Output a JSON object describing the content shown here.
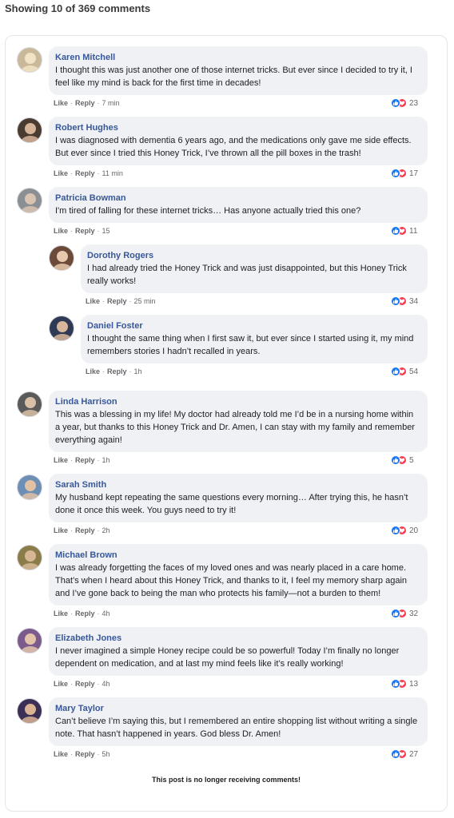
{
  "header": {
    "title": "Showing 10 of 369 comments"
  },
  "actions": {
    "like": "Like",
    "reply": "Reply"
  },
  "colors": {
    "link": "#385898",
    "bubble": "#eff1f5",
    "like": "#1877f2",
    "love": "#f33e58"
  },
  "comments": [
    {
      "author": "Karen Mitchell",
      "text": "I thought this was just another one of those internet tricks. But ever since I decided to try it, I feel like my mind is back for the first time in decades!",
      "time": "7 min",
      "reactions": "23",
      "avatar": "avatar-icon"
    },
    {
      "author": "Robert Hughes",
      "text": "I was diagnosed with dementia 6 years ago, and the medications only gave me side effects. But ever since I tried this Honey Trick, I’ve thrown all the pill boxes in the trash!",
      "time": "11 min",
      "reactions": "17",
      "avatar": "avatar-icon"
    },
    {
      "author": "Patricia Bowman",
      "text": "I'm tired of falling for these internet tricks… Has anyone actually tried this one?",
      "time": "15",
      "reactions": "11",
      "avatar": "avatar-icon"
    },
    {
      "author": "Dorothy Rogers",
      "text": "I had already tried the Honey Trick and was just disappointed, but this Honey Trick really works!",
      "time": "25 min",
      "reactions": "34",
      "avatar": "avatar-icon"
    },
    {
      "author": "Daniel Foster",
      "text": "I thought the same thing when I first saw it, but ever since I started using it, my mind remembers stories I hadn’t recalled in years.",
      "time": "1h",
      "reactions": "54",
      "avatar": "avatar-icon"
    },
    {
      "author": "Linda Harrison",
      "text": "This was a blessing in my life! My doctor had already told me I’d be in a nursing home within a year, but thanks to this Honey Trick and Dr. Amen, I can stay with my family and remember everything again!",
      "time": "1h",
      "reactions": "5",
      "avatar": "avatar-icon"
    },
    {
      "author": "Sarah Smith",
      "text": "My husband kept repeating the same questions every morning… After trying this, he hasn’t done it once this week. You guys need to try it!",
      "time": "2h",
      "reactions": "20",
      "avatar": "avatar-icon"
    },
    {
      "author": "Michael Brown",
      "text": "I was already forgetting the faces of my loved ones and was nearly placed in a care home. That’s when I heard about this Honey Trick, and thanks to it, I feel my memory sharp again and I’ve gone back to being the man who protects his family—not a burden to them!",
      "time": "4h",
      "reactions": "32",
      "avatar": "avatar-icon"
    },
    {
      "author": "Elizabeth Jones",
      "text": "I never imagined a simple Honey recipe could be so powerful! Today I’m finally no longer dependent on medication, and at last my mind feels like it’s really working!",
      "time": "4h",
      "reactions": "13",
      "avatar": "avatar-icon"
    },
    {
      "author": "Mary Taylor",
      "text": "Can’t believe I’m saying this, but I remembered an entire shopping list without writing a single note. That hasn’t happened in years. God bless Dr. Amen!",
      "time": "5h",
      "reactions": "27",
      "avatar": "avatar-icon"
    }
  ],
  "footer": {
    "notice": "This post is no longer receiving comments!"
  }
}
